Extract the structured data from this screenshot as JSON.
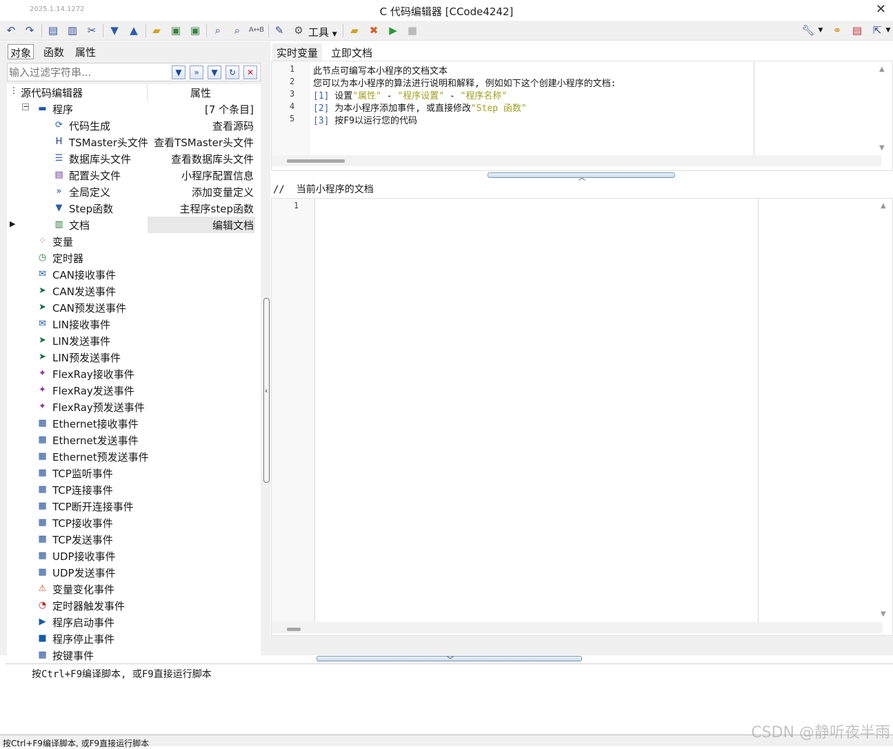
{
  "window": {
    "version": "2025.1.14.1272",
    "title": "C 代码编辑器 [CCode4242]",
    "close": "✕"
  },
  "toolbar": {
    "tools_label": "工具"
  },
  "left_panel": {
    "tabs": [
      "对象",
      "函数",
      "属性"
    ],
    "filter_placeholder": "输入过滤字符串...",
    "tree_header": {
      "name": "源代码编辑器",
      "attr": "属性"
    },
    "program": {
      "label": "程序",
      "attr": "[7 个条目]"
    },
    "program_children": [
      {
        "label": "代码生成",
        "attr": "查看源码",
        "icon": "gear-refresh-icon"
      },
      {
        "label": "TSMaster头文件",
        "attr": "查看TSMaster头文件",
        "icon": "h-icon"
      },
      {
        "label": "数据库头文件",
        "attr": "查看数据库头文件",
        "icon": "database-icon"
      },
      {
        "label": "配置头文件",
        "attr": "小程序配置信息",
        "icon": "config-doc-icon"
      },
      {
        "label": "全局定义",
        "attr": "添加变量定义",
        "icon": "global-icon"
      },
      {
        "label": "Step函数",
        "attr": "主程序step函数",
        "icon": "triangle-down-icon"
      },
      {
        "label": "文档",
        "attr": "编辑文档",
        "icon": "book-icon"
      }
    ],
    "items": [
      {
        "label": "变量",
        "icon": "variables-icon"
      },
      {
        "label": "定时器",
        "icon": "clock-icon"
      },
      {
        "label": "CAN接收事件",
        "icon": "envelope-icon"
      },
      {
        "label": "CAN发送事件",
        "icon": "send-icon"
      },
      {
        "label": "CAN预发送事件",
        "icon": "send-icon"
      },
      {
        "label": "LIN接收事件",
        "icon": "envelope-icon"
      },
      {
        "label": "LIN发送事件",
        "icon": "send-icon"
      },
      {
        "label": "LIN预发送事件",
        "icon": "send-icon"
      },
      {
        "label": "FlexRay接收事件",
        "icon": "flexray-icon"
      },
      {
        "label": "FlexRay发送事件",
        "icon": "flexray-icon"
      },
      {
        "label": "FlexRay预发送事件",
        "icon": "flexray-icon"
      },
      {
        "label": "Ethernet接收事件",
        "icon": "ethernet-icon"
      },
      {
        "label": "Ethernet发送事件",
        "icon": "ethernet-icon"
      },
      {
        "label": "Ethernet预发送事件",
        "icon": "ethernet-icon"
      },
      {
        "label": "TCP监听事件",
        "icon": "ethernet-icon"
      },
      {
        "label": "TCP连接事件",
        "icon": "ethernet-icon"
      },
      {
        "label": "TCP断开连接事件",
        "icon": "ethernet-icon"
      },
      {
        "label": "TCP接收事件",
        "icon": "ethernet-icon"
      },
      {
        "label": "TCP发送事件",
        "icon": "ethernet-icon"
      },
      {
        "label": "UDP接收事件",
        "icon": "ethernet-icon"
      },
      {
        "label": "UDP发送事件",
        "icon": "ethernet-icon"
      },
      {
        "label": "变量变化事件",
        "icon": "variable-change-icon"
      },
      {
        "label": "定时器触发事件",
        "icon": "timer-trigger-icon"
      },
      {
        "label": "程序启动事件",
        "icon": "play-icon"
      },
      {
        "label": "程序停止事件",
        "icon": "stop-icon"
      },
      {
        "label": "按键事件",
        "icon": "ethernet-icon"
      }
    ]
  },
  "right_panel": {
    "tabs": [
      "实时变量",
      "立即文档"
    ],
    "help_editor": {
      "line_numbers": [
        "1",
        "2",
        "3",
        "4",
        "5"
      ],
      "line1": "此节点可编写本小程序的文档文本",
      "line2": "您可以为本小程序的算法进行说明和解释, 例如如下这个创建小程序的文档:",
      "line3": {
        "num": "[1]",
        "a": " 设置",
        "s1": "\"属性\"",
        "b": " - ",
        "s2": "\"程序设置\"",
        "c": " - ",
        "s3": "\"程序名称\""
      },
      "line4": {
        "num": "[2]",
        "a": " 为本小程序添加事件, 或直接修改",
        "s1": "\"Step 函数\""
      },
      "line5": {
        "num": "[3]",
        "a": " 按F9以运行您的代码"
      }
    },
    "doc_header": "//  当前小程序的文档",
    "doc_editor": {
      "line_numbers": [
        "1"
      ]
    }
  },
  "output": {
    "message": "按Ctrl+F9编译脚本, 或F9直接运行脚本"
  },
  "statusbar": {
    "text": "按Ctrl+F9编译脚本, 或F9直接运行脚本"
  },
  "watermark": "CSDN @静听夜半雨",
  "colors": {
    "background": "#f0f0f0",
    "string_literal": "#a0a020",
    "selection_row": "#e8e8e8",
    "icon_blue": "#2a5caa"
  }
}
